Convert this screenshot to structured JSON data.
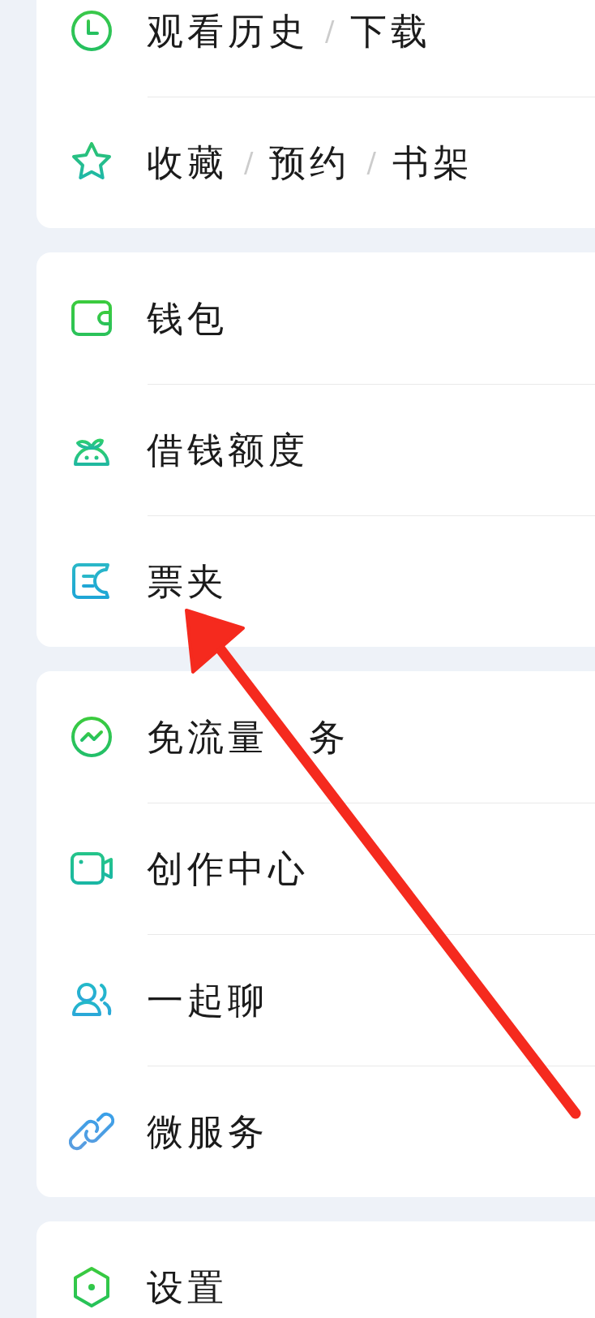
{
  "groups": [
    {
      "items": [
        {
          "segments": [
            {
              "kind": "text",
              "text": "观看历史"
            },
            {
              "kind": "separator",
              "text": "/"
            },
            {
              "kind": "text",
              "text": "下载"
            }
          ]
        },
        {
          "segments": [
            {
              "kind": "text",
              "text": "收藏"
            },
            {
              "kind": "separator",
              "text": "/"
            },
            {
              "kind": "text",
              "text": "预约"
            },
            {
              "kind": "separator",
              "text": "/"
            },
            {
              "kind": "text",
              "text": "书架"
            }
          ]
        }
      ]
    },
    {
      "items": [
        {
          "segments": [
            {
              "kind": "text",
              "text": "钱包"
            }
          ]
        },
        {
          "segments": [
            {
              "kind": "text",
              "text": "借钱额度"
            }
          ]
        },
        {
          "segments": [
            {
              "kind": "text",
              "text": "票夹"
            }
          ]
        }
      ]
    },
    {
      "items": [
        {
          "segments": [
            {
              "kind": "text",
              "text": "免流量"
            },
            {
              "kind": "covered"
            },
            {
              "kind": "text",
              "text": "务"
            }
          ]
        },
        {
          "segments": [
            {
              "kind": "text",
              "text": "创作中心"
            }
          ]
        },
        {
          "segments": [
            {
              "kind": "text",
              "text": "一起聊"
            }
          ]
        },
        {
          "segments": [
            {
              "kind": "text",
              "text": "微服务"
            }
          ]
        }
      ]
    },
    {
      "items": [
        {
          "segments": [
            {
              "kind": "text",
              "text": "设置"
            }
          ]
        }
      ]
    }
  ]
}
